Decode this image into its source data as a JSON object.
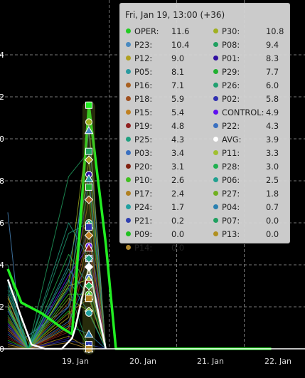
{
  "chart_data": {
    "type": "line",
    "x_axis": {
      "tick_labels": [
        "19. Jan",
        "20. Jan",
        "21. Jan",
        "22. Jan"
      ]
    },
    "y_axis": {
      "tick_labels": [
        "4",
        "2",
        "0",
        "8",
        "6",
        "4",
        "2",
        "0"
      ],
      "range": [
        0,
        14
      ]
    },
    "grid": true,
    "tooltip": {
      "header": "Fri, Jan 19, 13:00 (+36)",
      "left": [
        {
          "name": "OPER:",
          "value": "11.6",
          "color": "#22cc22"
        },
        {
          "name": "P23:",
          "value": "10.4",
          "color": "#4a8ac0"
        },
        {
          "name": "P12:",
          "value": "9.0",
          "color": "#b0a020"
        },
        {
          "name": "P05:",
          "value": "8.1",
          "color": "#2a9aa0"
        },
        {
          "name": "P16:",
          "value": "7.1",
          "color": "#a86020"
        },
        {
          "name": "P18:",
          "value": "5.9",
          "color": "#a05020"
        },
        {
          "name": "P15:",
          "value": "5.4",
          "color": "#c08020"
        },
        {
          "name": "P19:",
          "value": "4.8",
          "color": "#902020"
        },
        {
          "name": "P25:",
          "value": "4.3",
          "color": "#20a080"
        },
        {
          "name": "P03:",
          "value": "3.4",
          "color": "#3a70c0"
        },
        {
          "name": "P20:",
          "value": "3.1",
          "color": "#802010"
        },
        {
          "name": "P10:",
          "value": "2.6",
          "color": "#40c020"
        },
        {
          "name": "P17:",
          "value": "2.4",
          "color": "#b08020"
        },
        {
          "name": "P24:",
          "value": "1.7",
          "color": "#20a0a0"
        },
        {
          "name": "P21:",
          "value": "0.2",
          "color": "#3040b0"
        },
        {
          "name": "P09:",
          "value": "0.0",
          "color": "#20c020"
        },
        {
          "name": "P14:",
          "value": "0.0",
          "color": "#b08830"
        }
      ],
      "right": [
        {
          "name": "P30:",
          "value": "10.8",
          "color": "#a0b020"
        },
        {
          "name": "P08:",
          "value": "9.4",
          "color": "#20a060"
        },
        {
          "name": "P01:",
          "value": "8.3",
          "color": "#3010a0"
        },
        {
          "name": "P29:",
          "value": "7.7",
          "color": "#20b030"
        },
        {
          "name": "P26:",
          "value": "6.0",
          "color": "#20a070"
        },
        {
          "name": "P02:",
          "value": "5.8",
          "color": "#3030b0"
        },
        {
          "name": "CONTROL:",
          "value": "4.9",
          "color": "#6010f0"
        },
        {
          "name": "P22:",
          "value": "4.3",
          "color": "#3a70c0"
        },
        {
          "name": "AVG:",
          "value": "3.9",
          "color": "#ffffff"
        },
        {
          "name": "P11:",
          "value": "3.3",
          "color": "#a0c030"
        },
        {
          "name": "P28:",
          "value": "3.0",
          "color": "#20b050"
        },
        {
          "name": "P06:",
          "value": "2.5",
          "color": "#20a090"
        },
        {
          "name": "P27:",
          "value": "1.8",
          "color": "#70b020"
        },
        {
          "name": "P04:",
          "value": "0.7",
          "color": "#2a80b0"
        },
        {
          "name": "P07:",
          "value": "0.0",
          "color": "#20a060"
        },
        {
          "name": "P13:",
          "value": "0.0",
          "color": "#b09020"
        }
      ]
    },
    "series": [
      {
        "name": "OPER",
        "color": "#22ee22",
        "emphasis": "thick",
        "points": [
          [
            0.0,
            3.8
          ],
          [
            0.2,
            2.2
          ],
          [
            0.5,
            1.7
          ],
          [
            0.8,
            1.0
          ],
          [
            0.95,
            0.7
          ],
          [
            1.0,
            2.8
          ],
          [
            1.2,
            11.6
          ],
          [
            1.45,
            5.0
          ],
          [
            1.6,
            0.0
          ],
          [
            3.9,
            0.0
          ]
        ]
      },
      {
        "name": "AVG",
        "color": "#ffffff",
        "emphasis": "white",
        "points": [
          [
            0.0,
            3.3
          ],
          [
            0.2,
            1.5
          ],
          [
            0.35,
            0.2
          ],
          [
            0.55,
            0.0
          ],
          [
            0.8,
            0.0
          ],
          [
            0.95,
            0.5
          ],
          [
            1.0,
            1.0
          ],
          [
            1.2,
            3.9
          ],
          [
            1.45,
            0.0
          ]
        ]
      },
      {
        "name": "P30",
        "color": "#a0b020",
        "points": [
          [
            0.0,
            2.4
          ],
          [
            0.35,
            0.0
          ],
          [
            0.9,
            3.2
          ],
          [
            1.2,
            10.8
          ],
          [
            1.45,
            0.0
          ]
        ]
      },
      {
        "name": "P23",
        "color": "#4a8ac0",
        "points": [
          [
            0.0,
            6.5
          ],
          [
            0.2,
            0.4
          ],
          [
            0.9,
            2.0
          ],
          [
            1.2,
            10.4
          ],
          [
            1.45,
            0.0
          ]
        ]
      },
      {
        "name": "P08",
        "color": "#20a060",
        "points": [
          [
            0.0,
            4.0
          ],
          [
            0.3,
            0.0
          ],
          [
            0.9,
            8.2
          ],
          [
            1.2,
            9.4
          ],
          [
            1.45,
            0.0
          ]
        ]
      },
      {
        "name": "P12",
        "color": "#b0a020",
        "points": [
          [
            0.0,
            2.2
          ],
          [
            0.3,
            0.0
          ],
          [
            0.9,
            1.5
          ],
          [
            1.2,
            9.0
          ],
          [
            1.45,
            0.0
          ]
        ]
      },
      {
        "name": "P01",
        "color": "#3010a0",
        "points": [
          [
            0.0,
            1.0
          ],
          [
            0.3,
            0.0
          ],
          [
            0.9,
            0.5
          ],
          [
            1.2,
            8.3
          ],
          [
            1.45,
            0.0
          ]
        ]
      },
      {
        "name": "P05",
        "color": "#2a9aa0",
        "points": [
          [
            0.0,
            3.0
          ],
          [
            0.3,
            0.0
          ],
          [
            0.9,
            4.0
          ],
          [
            1.2,
            8.1
          ],
          [
            1.45,
            0.0
          ]
        ]
      },
      {
        "name": "P29",
        "color": "#20b030",
        "points": [
          [
            0.0,
            2.0
          ],
          [
            0.3,
            0.0
          ],
          [
            0.9,
            3.0
          ],
          [
            1.2,
            7.7
          ],
          [
            1.45,
            0.0
          ]
        ]
      },
      {
        "name": "P16",
        "color": "#a86020",
        "points": [
          [
            0.0,
            1.5
          ],
          [
            0.3,
            0.0
          ],
          [
            0.9,
            2.2
          ],
          [
            1.2,
            7.1
          ],
          [
            1.45,
            0.0
          ]
        ]
      },
      {
        "name": "P26",
        "color": "#20a070",
        "points": [
          [
            0.0,
            2.8
          ],
          [
            0.3,
            0.0
          ],
          [
            0.9,
            5.5
          ],
          [
            1.2,
            6.0
          ],
          [
            1.45,
            0.0
          ]
        ]
      },
      {
        "name": "P18",
        "color": "#a05020",
        "points": [
          [
            0.0,
            1.0
          ],
          [
            0.3,
            0.0
          ],
          [
            0.9,
            1.2
          ],
          [
            1.2,
            5.9
          ],
          [
            1.45,
            0.0
          ]
        ]
      },
      {
        "name": "P02",
        "color": "#3030b0",
        "points": [
          [
            0.0,
            0.8
          ],
          [
            0.3,
            0.0
          ],
          [
            0.9,
            2.8
          ],
          [
            1.2,
            5.8
          ],
          [
            1.45,
            0.0
          ]
        ]
      },
      {
        "name": "P15",
        "color": "#c08020",
        "points": [
          [
            0.0,
            2.5
          ],
          [
            0.3,
            0.0
          ],
          [
            0.9,
            1.0
          ],
          [
            1.2,
            5.4
          ],
          [
            1.45,
            0.0
          ]
        ]
      },
      {
        "name": "CONTROL",
        "color": "#6010f0",
        "points": [
          [
            0.0,
            1.2
          ],
          [
            0.3,
            0.0
          ],
          [
            0.9,
            3.5
          ],
          [
            1.2,
            4.9
          ],
          [
            1.45,
            0.0
          ]
        ]
      },
      {
        "name": "P19",
        "color": "#902020",
        "points": [
          [
            0.0,
            0.6
          ],
          [
            0.3,
            0.0
          ],
          [
            0.9,
            0.8
          ],
          [
            1.2,
            4.8
          ],
          [
            1.45,
            0.0
          ]
        ]
      },
      {
        "name": "P22",
        "color": "#3a70c0",
        "points": [
          [
            0.0,
            1.8
          ],
          [
            0.3,
            0.0
          ],
          [
            0.9,
            2.0
          ],
          [
            1.2,
            4.3
          ],
          [
            1.45,
            0.0
          ]
        ]
      },
      {
        "name": "P25",
        "color": "#20a080",
        "points": [
          [
            0.0,
            3.2
          ],
          [
            0.3,
            0.0
          ],
          [
            0.9,
            6.0
          ],
          [
            1.2,
            4.3
          ],
          [
            1.45,
            0.0
          ]
        ]
      },
      {
        "name": "P03",
        "color": "#3a70c0",
        "points": [
          [
            0.0,
            1.1
          ],
          [
            0.3,
            0.0
          ],
          [
            0.9,
            1.3
          ],
          [
            1.2,
            3.4
          ],
          [
            1.45,
            0.0
          ]
        ]
      },
      {
        "name": "P11",
        "color": "#a0c030",
        "points": [
          [
            0.0,
            2.0
          ],
          [
            0.3,
            0.0
          ],
          [
            0.9,
            3.0
          ],
          [
            1.2,
            3.3
          ],
          [
            1.45,
            0.0
          ]
        ]
      },
      {
        "name": "P20",
        "color": "#802010",
        "points": [
          [
            0.0,
            0.5
          ],
          [
            0.3,
            0.0
          ],
          [
            0.9,
            0.9
          ],
          [
            1.2,
            3.1
          ],
          [
            1.45,
            0.0
          ]
        ]
      },
      {
        "name": "P28",
        "color": "#20b050",
        "points": [
          [
            0.0,
            1.6
          ],
          [
            0.3,
            0.0
          ],
          [
            0.9,
            4.5
          ],
          [
            1.2,
            3.0
          ],
          [
            1.45,
            0.0
          ]
        ]
      },
      {
        "name": "P10",
        "color": "#40c020",
        "points": [
          [
            0.0,
            1.3
          ],
          [
            0.3,
            0.0
          ],
          [
            0.9,
            2.6
          ],
          [
            1.2,
            2.6
          ],
          [
            1.45,
            0.0
          ]
        ]
      },
      {
        "name": "P06",
        "color": "#20a090",
        "points": [
          [
            0.0,
            2.1
          ],
          [
            0.3,
            0.0
          ],
          [
            0.9,
            3.8
          ],
          [
            1.2,
            2.5
          ],
          [
            1.45,
            0.0
          ]
        ]
      },
      {
        "name": "P17",
        "color": "#b08020",
        "points": [
          [
            0.0,
            0.9
          ],
          [
            0.3,
            0.0
          ],
          [
            0.9,
            1.7
          ],
          [
            1.2,
            2.4
          ],
          [
            1.45,
            0.0
          ]
        ]
      },
      {
        "name": "P27",
        "color": "#70b020",
        "points": [
          [
            0.0,
            1.4
          ],
          [
            0.3,
            0.0
          ],
          [
            0.9,
            2.4
          ],
          [
            1.2,
            1.8
          ],
          [
            1.45,
            0.0
          ]
        ]
      },
      {
        "name": "P24",
        "color": "#20a0a0",
        "points": [
          [
            0.0,
            2.6
          ],
          [
            0.3,
            0.0
          ],
          [
            0.9,
            3.3
          ],
          [
            1.2,
            1.7
          ],
          [
            1.45,
            0.0
          ]
        ]
      },
      {
        "name": "P04",
        "color": "#2a80b0",
        "points": [
          [
            0.0,
            0.7
          ],
          [
            0.3,
            0.0
          ],
          [
            0.9,
            1.1
          ],
          [
            1.2,
            0.7
          ],
          [
            1.45,
            0.0
          ]
        ]
      },
      {
        "name": "P21",
        "color": "#3040b0",
        "points": [
          [
            0.0,
            0.3
          ],
          [
            0.3,
            0.0
          ],
          [
            0.9,
            0.4
          ],
          [
            1.2,
            0.2
          ],
          [
            1.45,
            0.0
          ]
        ]
      },
      {
        "name": "P07",
        "color": "#20a060",
        "points": [
          [
            0.0,
            1.9
          ],
          [
            0.3,
            0.0
          ],
          [
            0.9,
            2.9
          ],
          [
            1.2,
            0.0
          ],
          [
            1.45,
            0.0
          ]
        ]
      },
      {
        "name": "P09",
        "color": "#20c020",
        "points": [
          [
            0.0,
            0.4
          ],
          [
            0.3,
            0.0
          ],
          [
            0.9,
            1.8
          ],
          [
            1.2,
            0.0
          ],
          [
            1.45,
            0.0
          ]
        ]
      },
      {
        "name": "P13",
        "color": "#b09020",
        "points": [
          [
            0.0,
            0.2
          ],
          [
            0.3,
            0.0
          ],
          [
            0.9,
            0.6
          ],
          [
            1.2,
            0.0
          ],
          [
            1.45,
            0.0
          ]
        ]
      },
      {
        "name": "P14",
        "color": "#b08830",
        "points": [
          [
            0.0,
            0.1
          ],
          [
            0.3,
            0.0
          ],
          [
            0.9,
            0.3
          ],
          [
            1.2,
            0.0
          ],
          [
            1.45,
            0.0
          ]
        ]
      }
    ]
  }
}
